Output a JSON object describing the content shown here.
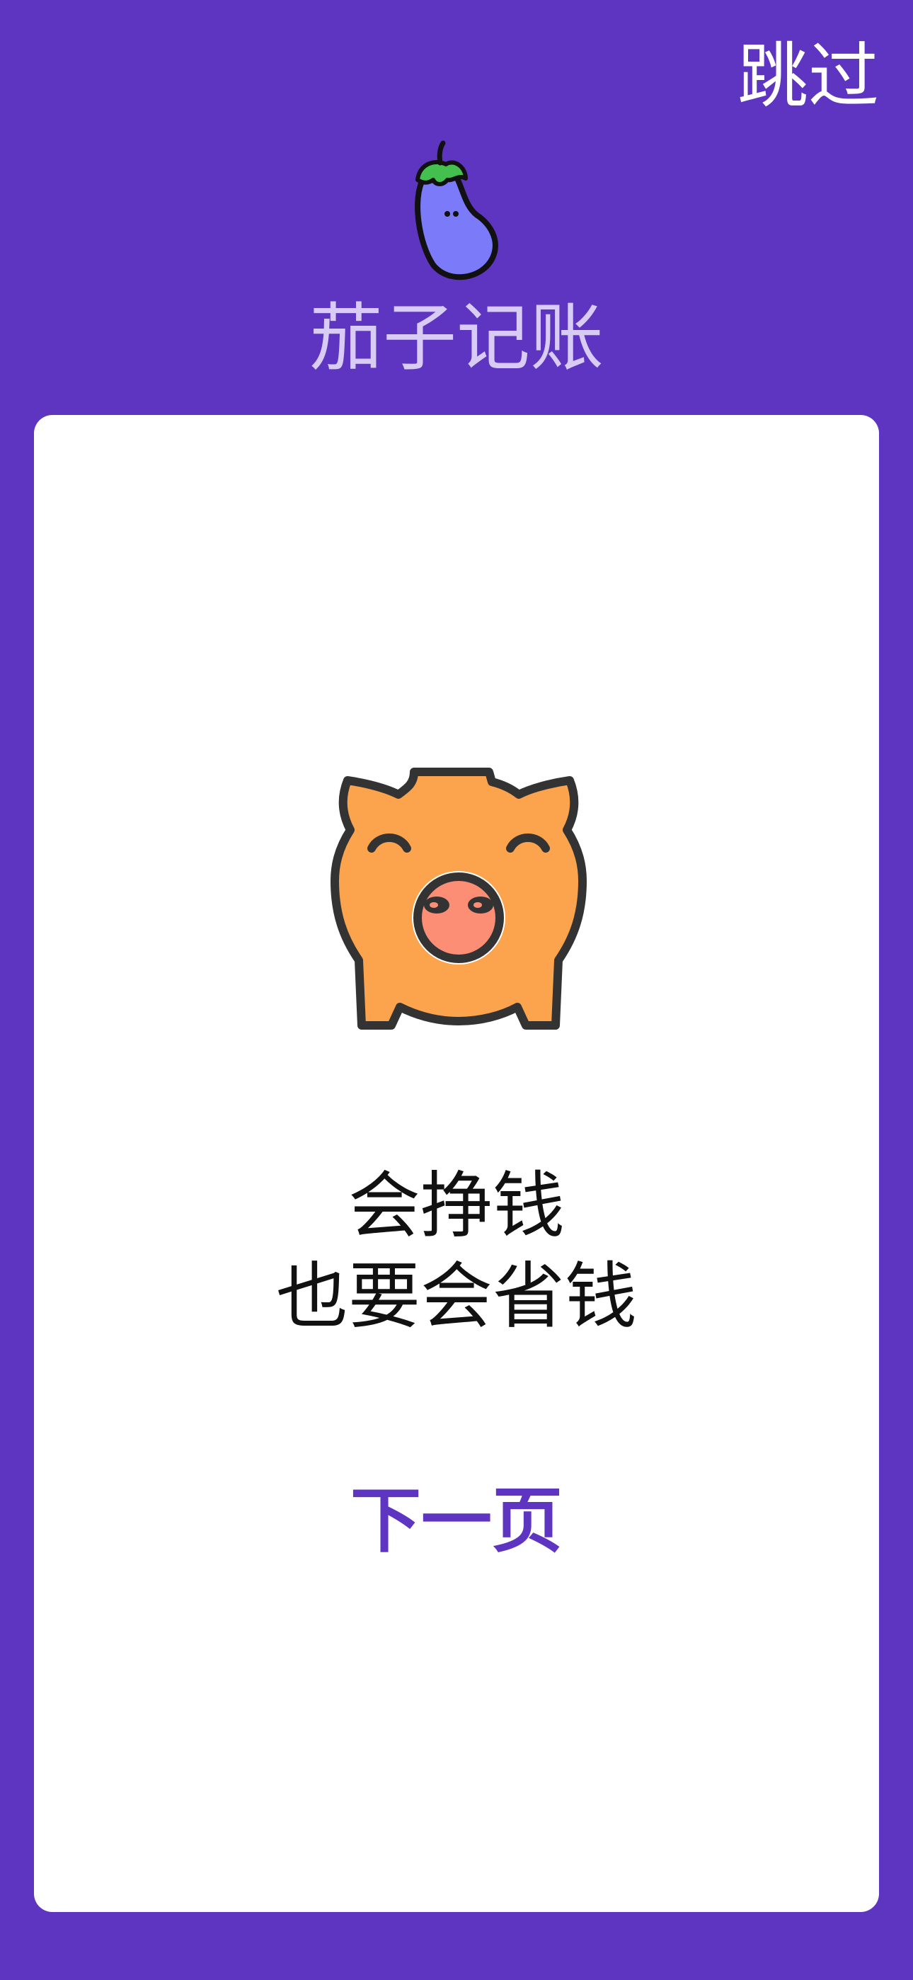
{
  "header": {
    "skip_label": "跳过",
    "app_name": "茄子记账",
    "logo_icon": "eggplant-icon"
  },
  "card": {
    "illustration_icon": "piggy-bank-icon",
    "slogan_line_1": "会挣钱",
    "slogan_line_2": "也要会省钱",
    "next_label": "下一页"
  },
  "colors": {
    "background": "#5e35c0",
    "card": "#ffffff",
    "accent": "#5e35c0",
    "title": "#d9ccf4",
    "pig_body": "#fba34d",
    "pig_snout": "#fb8e74"
  }
}
